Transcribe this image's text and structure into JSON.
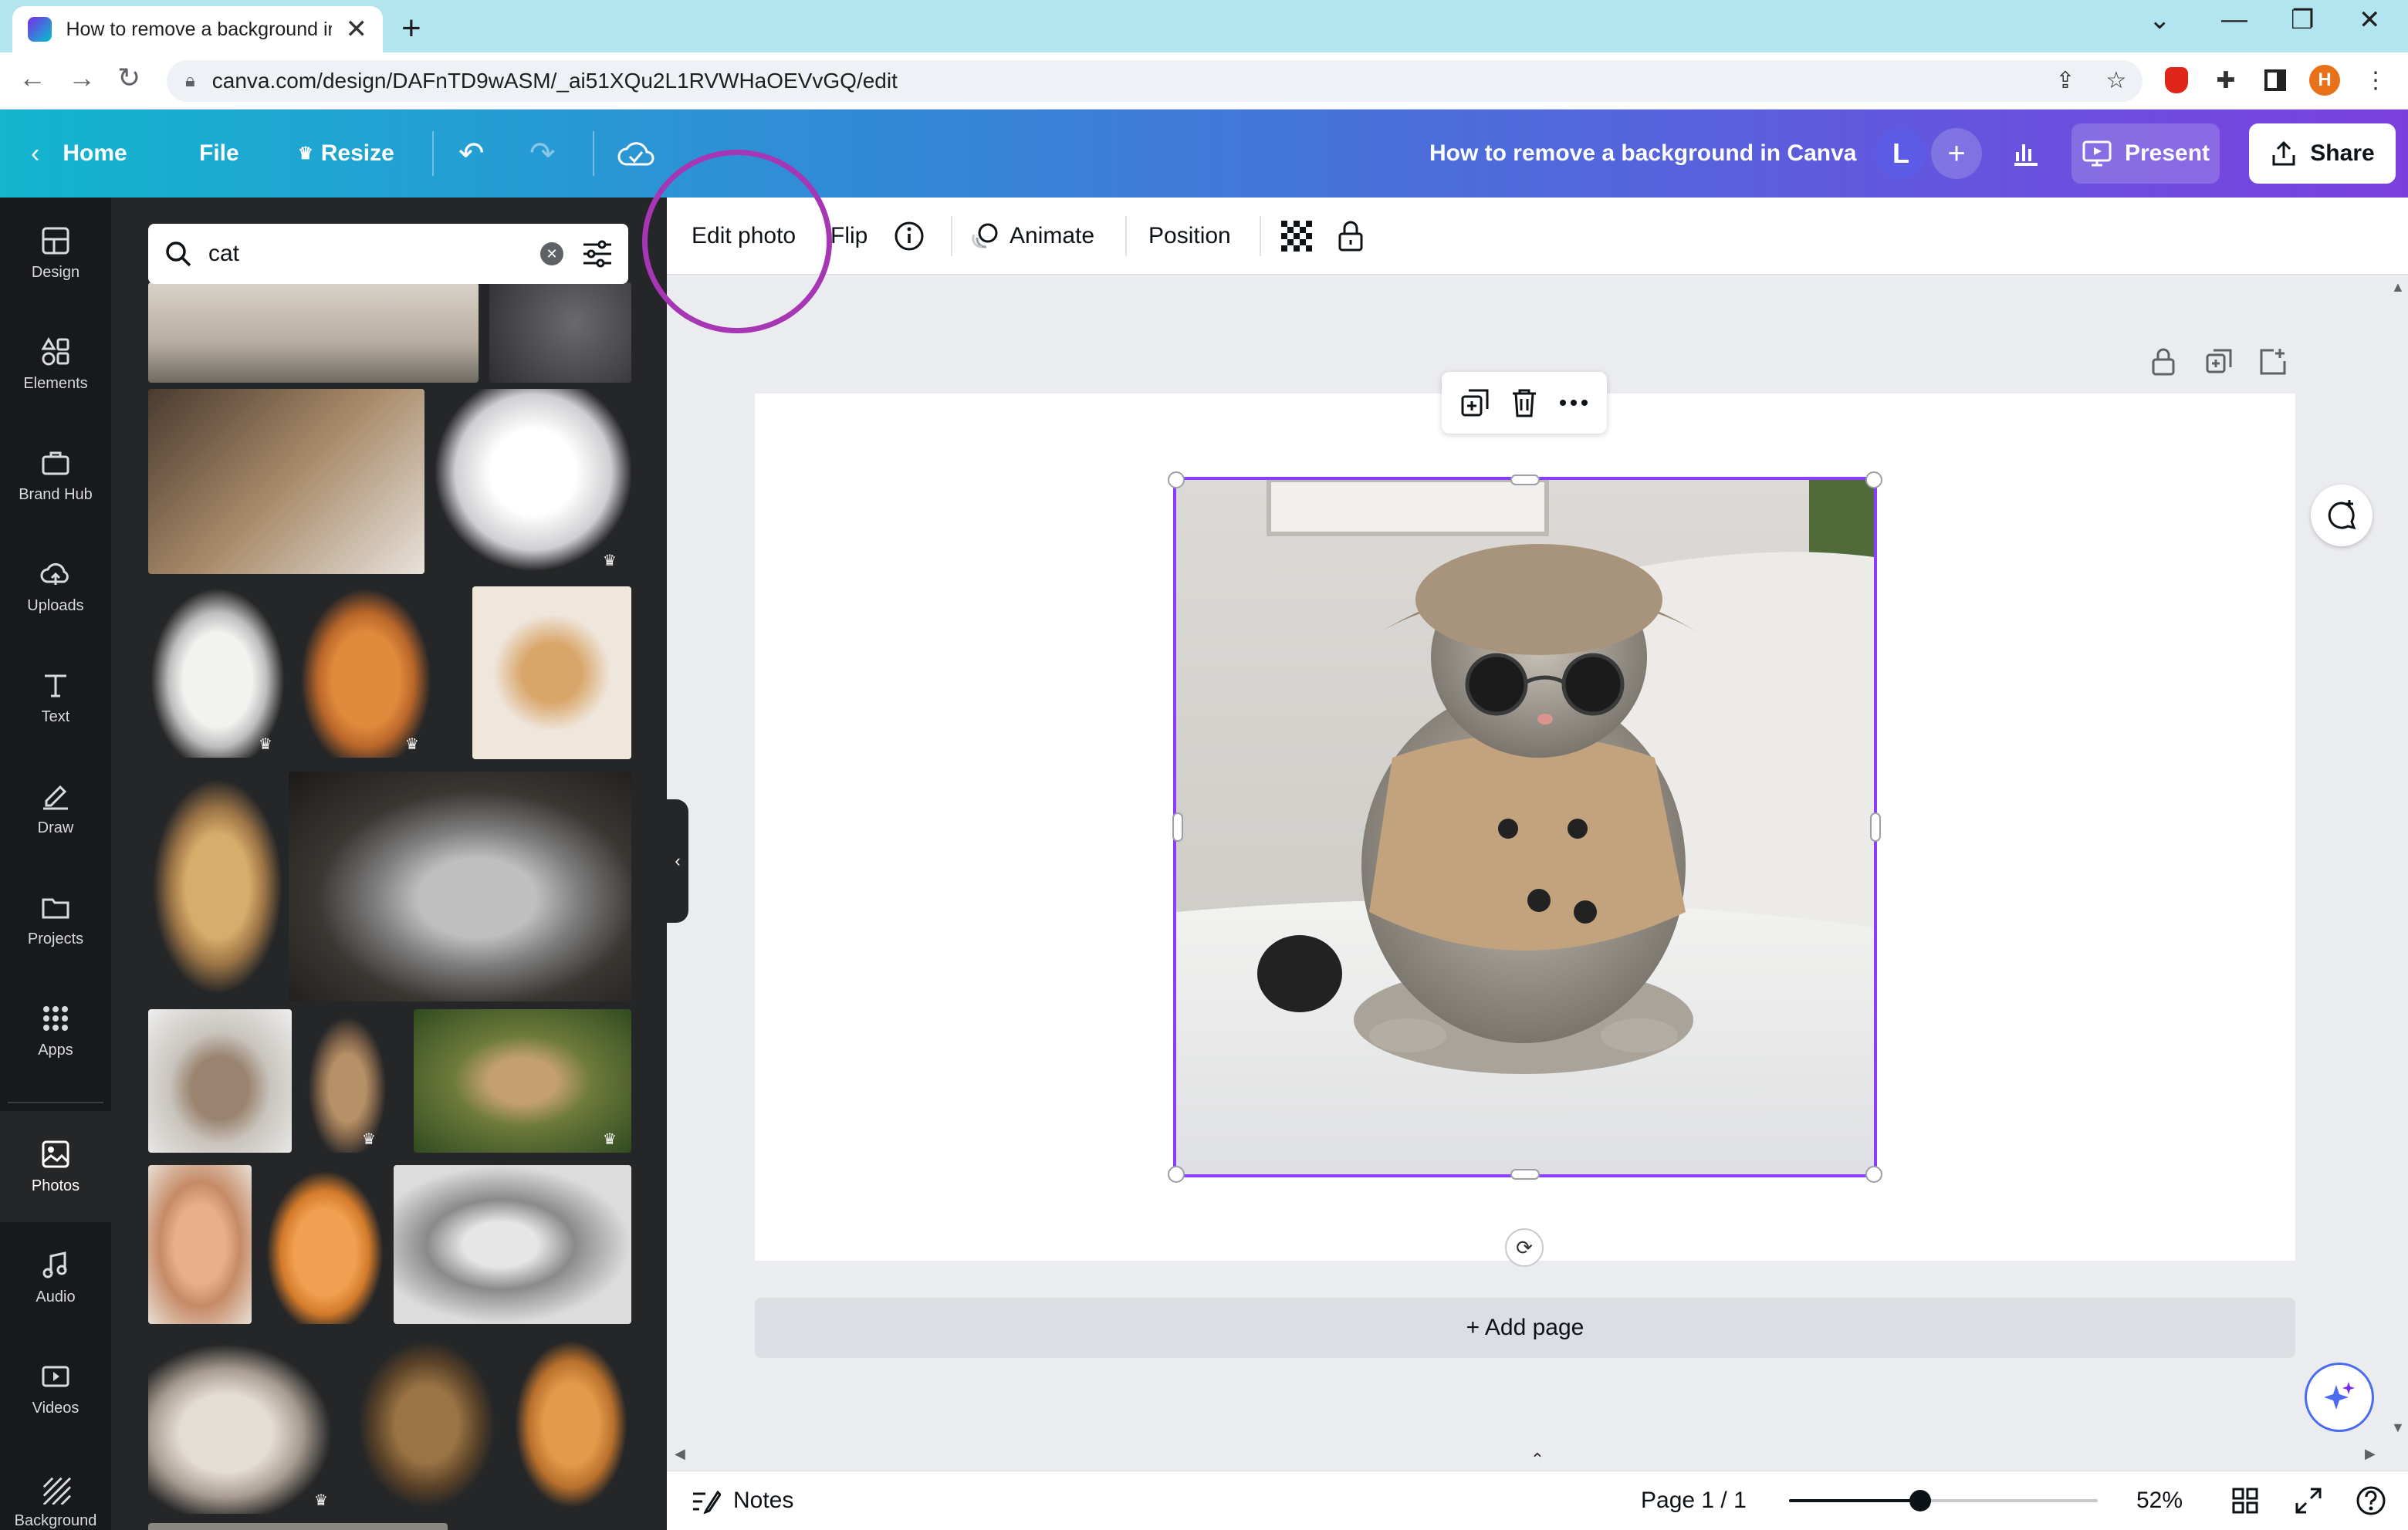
{
  "browser": {
    "tab_title": "How to remove a background in Canva",
    "url": "canva.com/design/DAFnTD9wASM/_ai51XQu2L1RVWHaOEVvGQ/edit",
    "profile_initial": "H"
  },
  "header": {
    "home": "Home",
    "file": "File",
    "resize": "Resize",
    "doc_title": "How to remove a background in Canva",
    "avatar_initial": "L",
    "present": "Present",
    "share": "Share"
  },
  "rail": {
    "items": [
      {
        "label": "Design",
        "icon": "layout-icon"
      },
      {
        "label": "Elements",
        "icon": "shapes-icon"
      },
      {
        "label": "Brand Hub",
        "icon": "briefcase-icon"
      },
      {
        "label": "Uploads",
        "icon": "cloud-upload-icon"
      },
      {
        "label": "Text",
        "icon": "text-icon"
      },
      {
        "label": "Draw",
        "icon": "pen-icon"
      },
      {
        "label": "Projects",
        "icon": "folder-icon"
      },
      {
        "label": "Apps",
        "icon": "grid-icon"
      },
      {
        "label": "Photos",
        "icon": "image-icon"
      },
      {
        "label": "Audio",
        "icon": "music-icon"
      },
      {
        "label": "Videos",
        "icon": "video-icon"
      },
      {
        "label": "Background",
        "icon": "stripes-icon"
      }
    ],
    "active": "Photos"
  },
  "search": {
    "value": "cat"
  },
  "context_toolbar": {
    "edit_photo": "Edit photo",
    "flip": "Flip",
    "animate": "Animate",
    "position": "Position"
  },
  "canvas": {
    "add_page": "+ Add page"
  },
  "footer": {
    "notes": "Notes",
    "page_indicator": "Page 1 / 1",
    "zoom": "52%",
    "zoom_fraction": 0.52
  },
  "colors": {
    "header_start": "#13b5cf",
    "header_end": "#7b3fe0",
    "selection": "#8b3dff",
    "highlight_circle": "#a636b4",
    "rail_bg": "#18191b",
    "panel_bg": "#252627"
  }
}
